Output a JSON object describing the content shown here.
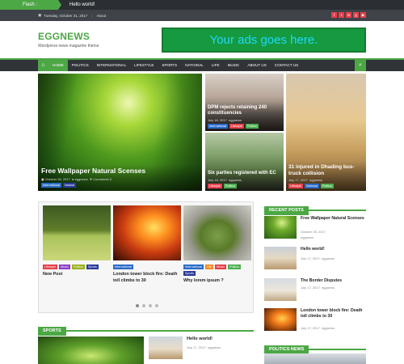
{
  "flash": {
    "label": "Flash :",
    "message": "Hello world!"
  },
  "topbar": {
    "date": "Tuesday, October 31, 2017",
    "about": "About"
  },
  "social": [
    {
      "icon": "facebook-icon",
      "glyph": "f",
      "color": "#e5404a"
    },
    {
      "icon": "twitter-icon",
      "glyph": "t",
      "color": "#e5404a"
    },
    {
      "icon": "linkedin-icon",
      "glyph": "in",
      "color": "#e5404a"
    },
    {
      "icon": "google-plus-icon",
      "glyph": "g",
      "color": "#e5404a"
    },
    {
      "icon": "youtube-icon",
      "glyph": "▶",
      "color": "#e5404a"
    }
  ],
  "header": {
    "site_title": "EGGNEWS",
    "tagline": "Wordpress news magazine theme",
    "ad_text": "Your ads goes here."
  },
  "nav": {
    "items": [
      "HOME",
      "POLITICS",
      "INTERNATIONAL",
      "LIFESTYLE",
      "SPORTS",
      "NATIONAL",
      "LIFE",
      "MUSIC",
      "ABOUT US",
      "CONTACT US"
    ],
    "active": "HOME"
  },
  "featured": {
    "main": {
      "title": "Free Wallpaper Natural Scenses",
      "date": "October 26, 2017",
      "author": "eggnews",
      "comments": "Comments 0",
      "tags": [
        "International",
        "Natural"
      ]
    },
    "tile1": {
      "title": "DPM rejects retaining 240 constituencies",
      "date": "July 18, 2017",
      "author": "eggnews",
      "tags": [
        "International",
        "Lifestyle",
        "Politics"
      ]
    },
    "tile2": {
      "title": "Six parties registered with EC",
      "date": "July 18, 2017",
      "author": "eggnews",
      "tags": [
        "Lifestyle",
        "Politics"
      ]
    },
    "tile3": {
      "title": "31 injured in Dhading bus-truck collision",
      "date": "July 17, 2017",
      "author": "eggnews",
      "tags": [
        "Lifestyle",
        "National",
        "Politics"
      ]
    }
  },
  "carousel": {
    "cards": [
      {
        "title": "New Post",
        "tags": [
          "Lifestyle",
          "Music",
          "Politics",
          "Sports"
        ]
      },
      {
        "title": "London tower block fire: Death toll climbs to 30",
        "tags": [
          "International"
        ]
      },
      {
        "title": "Why lorem ipsum ?",
        "tags": [
          "International",
          "Life",
          "Music",
          "Politics",
          "Sports"
        ]
      }
    ]
  },
  "recent_posts": {
    "heading": "RECENT POSTS",
    "items": [
      {
        "title": "Free Wallpaper Natural Scenses",
        "date": "October 26, 2017",
        "author": "eggnews"
      },
      {
        "title": "Hello world!",
        "date": "July 17, 2017",
        "author": "eggnews"
      },
      {
        "title": "The Border Disputes",
        "date": "July 17, 2017",
        "author": "eggnews"
      },
      {
        "title": "London tower block fire: Death toll climbs to 30",
        "date": "July 17, 2017",
        "author": "eggnews"
      }
    ]
  },
  "sports": {
    "heading": "SPORTS",
    "side_title": "Hello world!",
    "side_date": "July 17, 2017",
    "side_author": "eggnews"
  },
  "politics": {
    "heading": "POLITICS NEWS"
  },
  "colors": {
    "accent": "#4ca745"
  }
}
